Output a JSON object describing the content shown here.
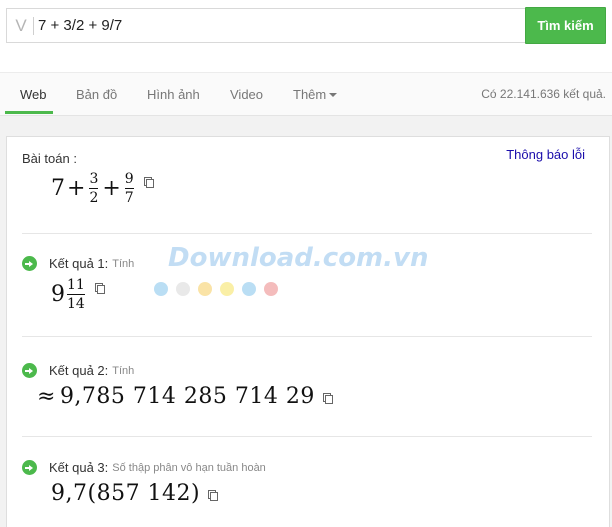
{
  "search": {
    "logo_glyph": "V",
    "query": "7 + 3/2 + 9/7",
    "button_label": "Tìm kiếm"
  },
  "nav": {
    "tabs": [
      {
        "label": "Web",
        "active": true
      },
      {
        "label": "Bản đồ",
        "active": false
      },
      {
        "label": "Hình ảnh",
        "active": false
      },
      {
        "label": "Video",
        "active": false
      },
      {
        "label": "Thêm",
        "active": false
      }
    ],
    "result_count": "Có 22.141.636 kết quả."
  },
  "problem": {
    "label": "Bài toán :",
    "report_link": "Thông báo lỗi",
    "expr": {
      "t1": "7",
      "plus1": "+",
      "f1_num": "3",
      "f1_den": "2",
      "plus2": "+",
      "f2_num": "9",
      "f2_den": "7"
    }
  },
  "results": [
    {
      "title": "Kết quả 1:",
      "subtitle": "Tính",
      "whole": "9",
      "num": "11",
      "den": "14"
    },
    {
      "title": "Kết quả 2:",
      "subtitle": "Tính",
      "approx": "≈",
      "value": "9,785 714 285 714 29"
    },
    {
      "title": "Kết quả 3:",
      "subtitle": "Số thập phân vô hạn tuần hoàn",
      "value": "9,7(857 142)"
    }
  ],
  "watermark": {
    "text": "Download.com.vn",
    "dot_colors": [
      "#3aa0e0",
      "#c0c0c0",
      "#f0b000",
      "#f0d000",
      "#3aa0e0",
      "#e04040"
    ]
  },
  "colors": {
    "accent_green": "#4cb94c",
    "link_blue": "#1a0dab"
  }
}
